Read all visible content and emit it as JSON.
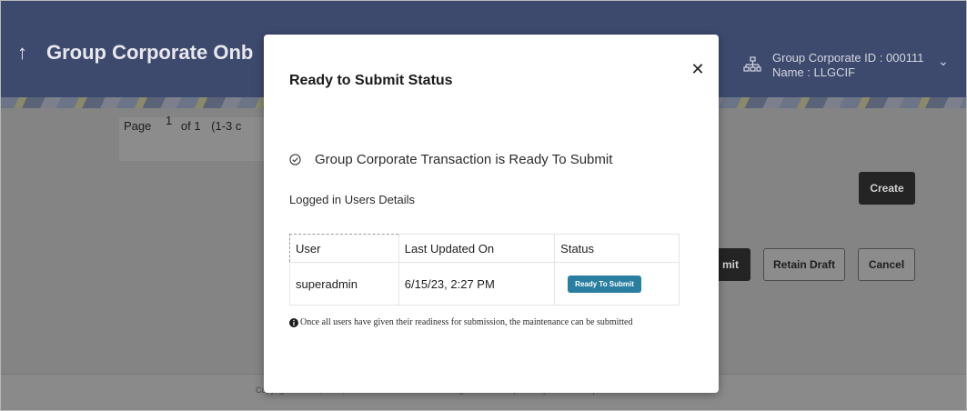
{
  "page": {
    "title": "Group Corporate Onb",
    "corporate_id_line": "Group Corporate ID : 000111",
    "corporate_name_line": "Name : LLGCIF"
  },
  "pager": {
    "page_label": "Page",
    "current": "1",
    "of_label": "of 1",
    "range_text": "(1-3 c"
  },
  "buttons": {
    "create": "Create",
    "submit_partial": "mit",
    "retain_draft": "Retain Draft",
    "cancel": "Cancel"
  },
  "footer": {
    "copyright": "Copyright © 2006, 2023, Oracle and/or its affiliates. All rights reserved. | Security Information | Terms and Conditions"
  },
  "modal": {
    "title": "Ready to Submit Status",
    "close_icon": "close-icon",
    "status_message": "Group Corporate Transaction is Ready To Submit",
    "users_heading": "Logged in Users Details",
    "table": {
      "headers": [
        "User",
        "Last Updated On",
        "Status"
      ],
      "rows": [
        {
          "user": "superadmin",
          "last_updated": "6/15/23, 2:27 PM",
          "status": "Ready To Submit"
        }
      ]
    },
    "note": "Once all users have given their readiness for submission, the maintenance can be submitted"
  },
  "colors": {
    "header_bg": "#3d4a6e",
    "badge": "#2a7fa1",
    "overlay_dim": "#848484"
  }
}
